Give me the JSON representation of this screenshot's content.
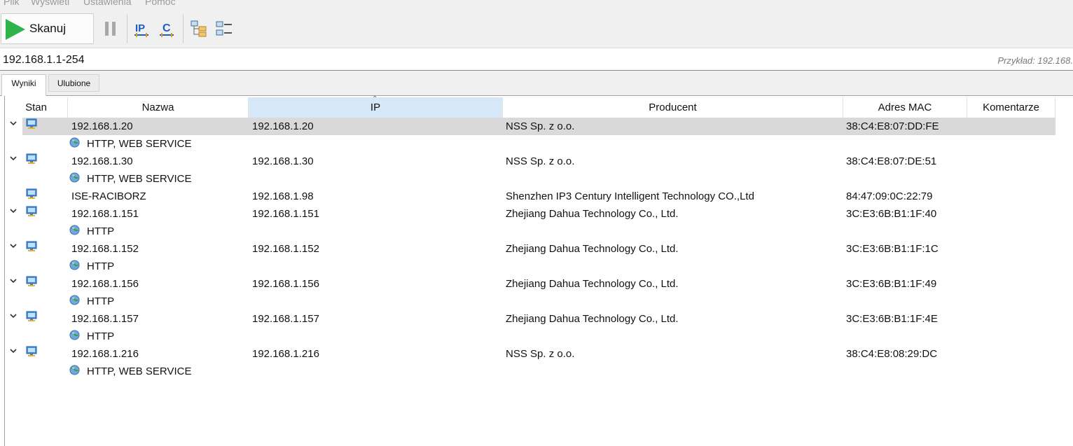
{
  "menu": {
    "items": [
      "Plik",
      "Wyświetl",
      "Ustawienia",
      "Pomoc"
    ]
  },
  "toolbar": {
    "scan_label": "Skanuj"
  },
  "address": {
    "value": "192.168.1.1-254",
    "hint": "Przykład: 192.168."
  },
  "tabs": [
    {
      "label": "Wyniki"
    },
    {
      "label": "Ulubione"
    }
  ],
  "table": {
    "columns": [
      "Stan",
      "Nazwa",
      "IP",
      "Producent",
      "Adres MAC",
      "Komentarze"
    ],
    "sorted_column": "IP",
    "rows": [
      {
        "name": "192.168.1.20",
        "ip": "192.168.1.20",
        "vendor": "NSS Sp. z o.o.",
        "mac": "38:C4:E8:07:DD:FE",
        "services": "HTTP, WEB SERVICE"
      },
      {
        "name": "192.168.1.30",
        "ip": "192.168.1.30",
        "vendor": "NSS Sp. z o.o.",
        "mac": "38:C4:E8:07:DE:51",
        "services": "HTTP, WEB SERVICE"
      },
      {
        "name": "ISE-RACIBORZ",
        "ip": "192.168.1.98",
        "vendor": "Shenzhen IP3 Century Intelligent Technology CO.,Ltd",
        "mac": "84:47:09:0C:22:79"
      },
      {
        "name": "192.168.1.151",
        "ip": "192.168.1.151",
        "vendor": "Zhejiang Dahua Technology Co., Ltd.",
        "mac": "3C:E3:6B:B1:1F:40",
        "services": "HTTP"
      },
      {
        "name": "192.168.1.152",
        "ip": "192.168.1.152",
        "vendor": "Zhejiang Dahua Technology Co., Ltd.",
        "mac": "3C:E3:6B:B1:1F:1C",
        "services": "HTTP"
      },
      {
        "name": "192.168.1.156",
        "ip": "192.168.1.156",
        "vendor": "Zhejiang Dahua Technology Co., Ltd.",
        "mac": "3C:E3:6B:B1:1F:49",
        "services": "HTTP"
      },
      {
        "name": "192.168.1.157",
        "ip": "192.168.1.157",
        "vendor": "Zhejiang Dahua Technology Co., Ltd.",
        "mac": "3C:E3:6B:B1:1F:4E",
        "services": "HTTP"
      },
      {
        "name": "192.168.1.216",
        "ip": "192.168.1.216",
        "vendor": "NSS Sp. z o.o.",
        "mac": "38:C4:E8:08:29:DC",
        "services": "HTTP, WEB SERVICE"
      }
    ]
  },
  "colors": {
    "accent": "#2fb34a",
    "selected_row": "#d9d9d9",
    "sorted_header": "#d6e8f8"
  }
}
